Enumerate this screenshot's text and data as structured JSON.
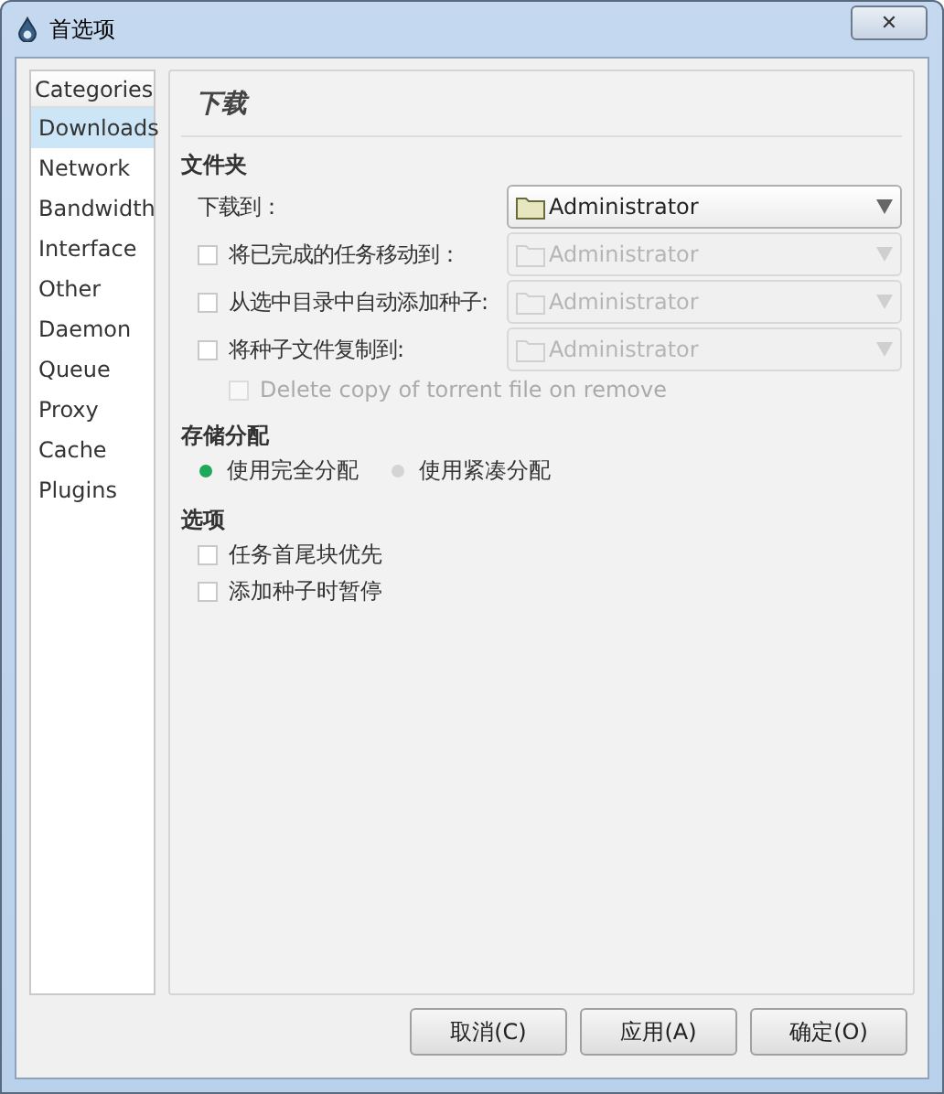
{
  "window": {
    "title": "首选项",
    "close": "✕"
  },
  "sidebar": {
    "header": "Categories",
    "items": [
      {
        "label": "Downloads",
        "selected": true
      },
      {
        "label": "Network",
        "selected": false
      },
      {
        "label": "Bandwidth",
        "selected": false
      },
      {
        "label": "Interface",
        "selected": false
      },
      {
        "label": "Other",
        "selected": false
      },
      {
        "label": "Daemon",
        "selected": false
      },
      {
        "label": "Queue",
        "selected": false
      },
      {
        "label": "Proxy",
        "selected": false
      },
      {
        "label": "Cache",
        "selected": false
      },
      {
        "label": "Plugins",
        "selected": false
      }
    ]
  },
  "page": {
    "title": "下载",
    "folders": {
      "title": "文件夹",
      "rows": [
        {
          "kind": "label",
          "label": "下载到：",
          "value": "Administrator",
          "disabled": false
        },
        {
          "kind": "checkbox",
          "label": "将已完成的任务移动到：",
          "checked": false,
          "value": "Administrator",
          "disabled": true
        },
        {
          "kind": "checkbox",
          "label": "从选中目录中自动添加种子:",
          "checked": false,
          "value": "Administrator",
          "disabled": true
        },
        {
          "kind": "checkbox",
          "label": "将种子文件复制到:",
          "checked": false,
          "value": "Administrator",
          "disabled": true
        }
      ],
      "delete_copy": {
        "label": "Delete copy of torrent file on remove",
        "checked": false,
        "disabled": true
      }
    },
    "allocation": {
      "title": "存储分配",
      "options": [
        {
          "label": "使用完全分配",
          "selected": true
        },
        {
          "label": "使用紧凑分配",
          "selected": false
        }
      ]
    },
    "options": {
      "title": "选项",
      "items": [
        {
          "label": "任务首尾块优先",
          "checked": false
        },
        {
          "label": "添加种子时暂停",
          "checked": false
        }
      ]
    }
  },
  "buttons": [
    "取消(C)",
    "应用(A)",
    "确定(O)"
  ]
}
